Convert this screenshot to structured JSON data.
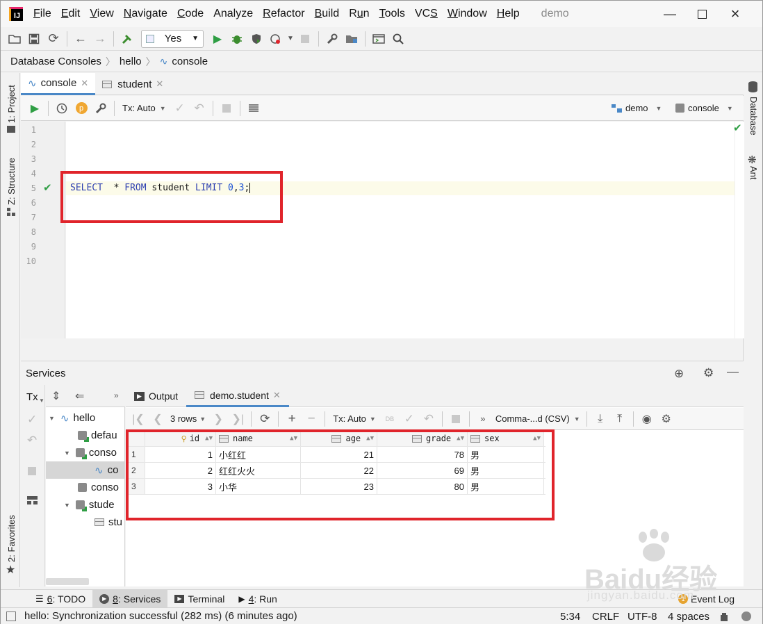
{
  "menu": {
    "items": [
      "File",
      "Edit",
      "View",
      "Navigate",
      "Code",
      "Analyze",
      "Refactor",
      "Build",
      "Run",
      "Tools",
      "VCS",
      "Window",
      "Help"
    ],
    "mnemonics": [
      "F",
      "E",
      "V",
      "N",
      "C",
      "",
      "R",
      "B",
      "u",
      "T",
      "S",
      "W",
      "H"
    ],
    "project_title": "demo"
  },
  "toolbar": {
    "run_config": "Yes"
  },
  "breadcrumb": [
    "Database Consoles",
    "hello",
    "console"
  ],
  "left_stripe": {
    "project": "1: Project",
    "structure": "Z: Structure",
    "favorites": "2: Favorites"
  },
  "right_stripe": {
    "database": "Database",
    "ant": "Ant"
  },
  "editor_tabs": [
    {
      "label": "console"
    },
    {
      "label": "student"
    }
  ],
  "editor_toolbar": {
    "tx_mode": "Tx: Auto",
    "datasource": "demo",
    "session": "console"
  },
  "editor": {
    "line_numbers": [
      "1",
      "2",
      "3",
      "4",
      "5",
      "6",
      "7",
      "8",
      "9",
      "10"
    ],
    "sql": {
      "kw1": "SELECT",
      "star": "  * ",
      "kw2": "FROM",
      "table": " student ",
      "kw3": "LIMIT",
      "num1": " 0",
      "comma": ",",
      "num2": "3",
      "end": ";"
    }
  },
  "services": {
    "title": "Services",
    "tx_label": "Tx",
    "tree": [
      {
        "label": "hello"
      },
      {
        "label": "defau"
      },
      {
        "label": "conso"
      },
      {
        "label": "co"
      },
      {
        "label": "conso"
      },
      {
        "label": "stude"
      },
      {
        "label": "stu"
      }
    ],
    "output_tabs": [
      {
        "label": "Output"
      },
      {
        "label": "demo.student"
      }
    ],
    "grid_toolbar": {
      "rows": "3 rows",
      "tx_mode": "Tx: Auto",
      "export_format": "Comma-...d (CSV)"
    }
  },
  "result_table": {
    "columns": [
      "id",
      "name",
      "age",
      "grade",
      "sex"
    ],
    "rows": [
      {
        "row": "1",
        "id": "1",
        "name": "小红红",
        "age": "21",
        "grade": "78",
        "sex": "男"
      },
      {
        "row": "2",
        "id": "2",
        "name": "红红火火",
        "age": "22",
        "grade": "69",
        "sex": "男"
      },
      {
        "row": "3",
        "id": "3",
        "name": "小华",
        "age": "23",
        "grade": "80",
        "sex": "男"
      }
    ]
  },
  "tool_tabs": [
    {
      "num": "6",
      "label": ": TODO"
    },
    {
      "num": "8",
      "label": ": Services"
    },
    {
      "num": "",
      "label": "Terminal"
    },
    {
      "num": "4",
      "label": ": Run"
    }
  ],
  "event_log": "Event Log",
  "status": {
    "message": "hello: Synchronization successful (282 ms) (6 minutes ago)",
    "position": "5:34",
    "line_sep": "CRLF",
    "encoding": "UTF-8",
    "indent": "4 spaces"
  },
  "watermark": {
    "brand": "Baidu经验",
    "url": "jingyan.baidu.com"
  },
  "colors": {
    "accent": "#4a88c7",
    "annotation": "#e0242b",
    "run_green": "#2f9e44"
  }
}
